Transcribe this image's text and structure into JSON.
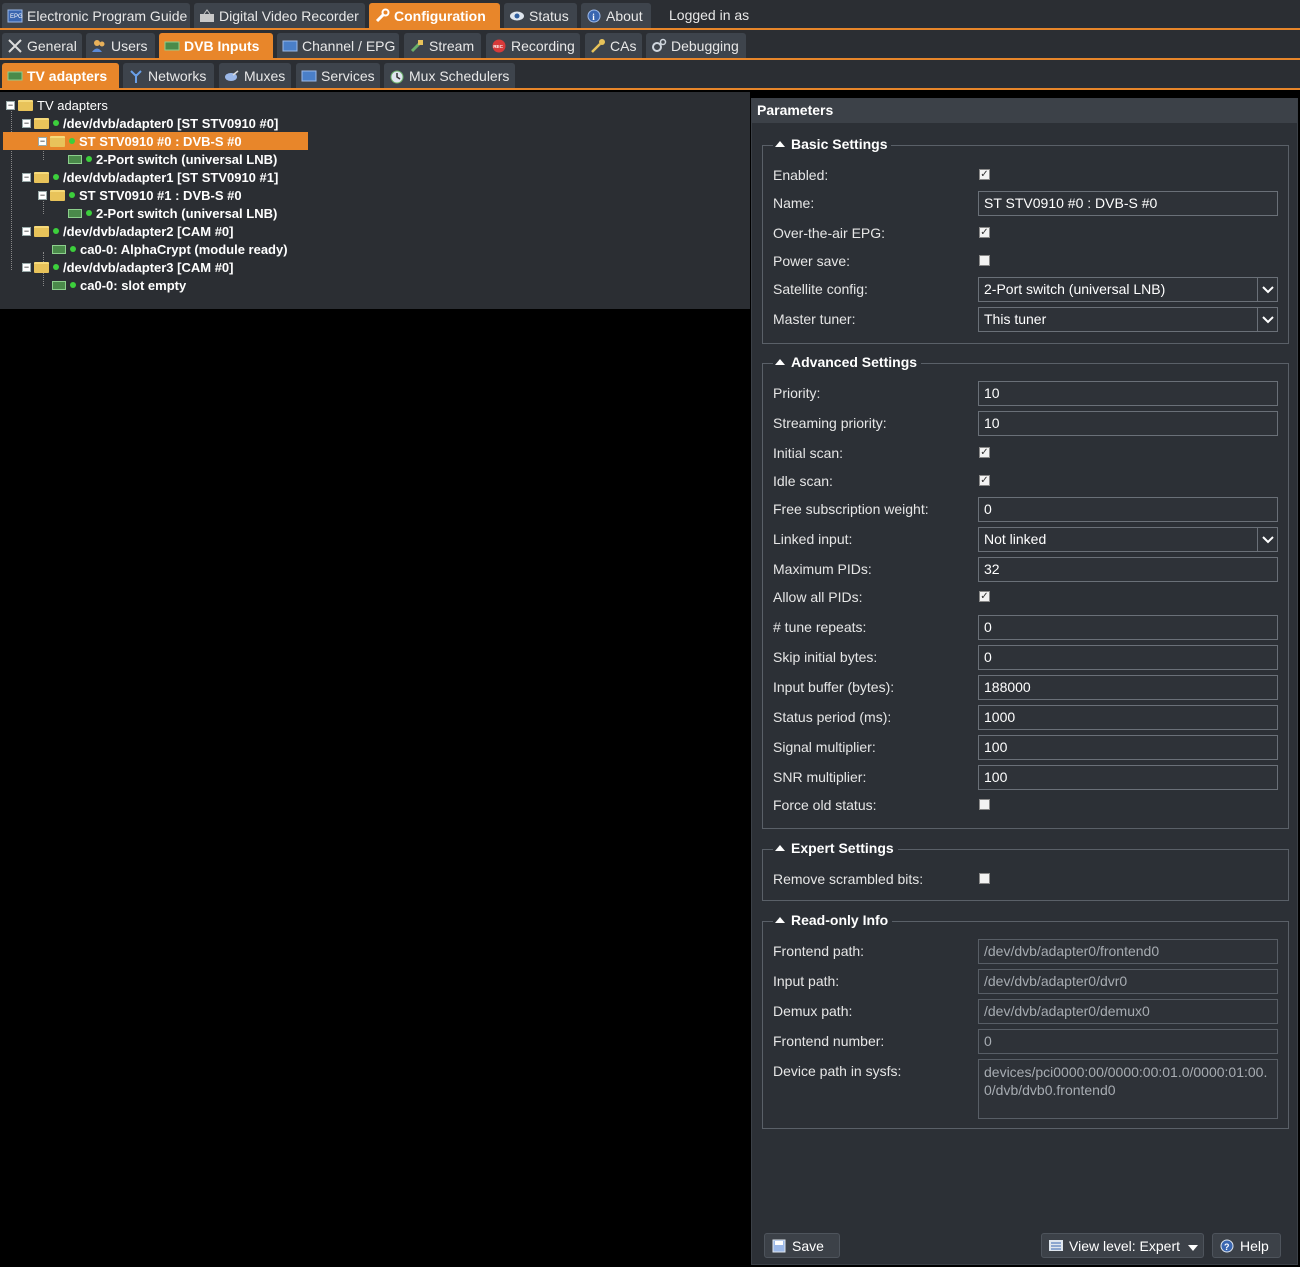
{
  "topnav": {
    "tabs": [
      {
        "label": "Electronic Program Guide",
        "icon": "epg-icon"
      },
      {
        "label": "Digital Video Recorder",
        "icon": "recorder-icon"
      },
      {
        "label": "Configuration",
        "icon": "wrench-icon",
        "active": true
      },
      {
        "label": "Status",
        "icon": "eye-icon"
      },
      {
        "label": "About",
        "icon": "info-icon"
      }
    ],
    "login_text": "Logged in as"
  },
  "confignav": {
    "tabs": [
      {
        "label": "General",
        "icon": "tools-icon"
      },
      {
        "label": "Users",
        "icon": "users-icon"
      },
      {
        "label": "DVB Inputs",
        "icon": "card-icon",
        "active": true
      },
      {
        "label": "Channel / EPG",
        "icon": "tv-icon"
      },
      {
        "label": "Stream",
        "icon": "stream-icon"
      },
      {
        "label": "Recording",
        "icon": "rec-icon"
      },
      {
        "label": "CAs",
        "icon": "key-icon"
      },
      {
        "label": "Debugging",
        "icon": "bug-icon"
      }
    ]
  },
  "dvbnav": {
    "tabs": [
      {
        "label": "TV adapters",
        "icon": "card-icon",
        "active": true
      },
      {
        "label": "Networks",
        "icon": "antenna-icon"
      },
      {
        "label": "Muxes",
        "icon": "satellite-icon"
      },
      {
        "label": "Services",
        "icon": "tv-icon"
      },
      {
        "label": "Mux Schedulers",
        "icon": "scheduler-icon"
      }
    ]
  },
  "tree": {
    "root": "TV adapters",
    "nodes": [
      "/dev/dvb/adapter0 [ST STV0910 #0]",
      "ST STV0910 #0 : DVB-S #0",
      "2-Port switch (universal LNB)",
      "/dev/dvb/adapter1 [ST STV0910 #1]",
      "ST STV0910 #1 : DVB-S #0",
      "2-Port switch (universal LNB)",
      "/dev/dvb/adapter2 [CAM #0]",
      "ca0-0: AlphaCrypt (module ready)",
      "/dev/dvb/adapter3 [CAM #0]",
      "ca0-0: slot empty"
    ]
  },
  "params": {
    "title": "Parameters",
    "basic": {
      "legend": "Basic Settings",
      "enabled_label": "Enabled:",
      "enabled": true,
      "name_label": "Name:",
      "name_value": "ST STV0910 #0 : DVB-S #0",
      "ota_epg_label": "Over-the-air EPG:",
      "ota_epg": true,
      "power_save_label": "Power save:",
      "power_save": false,
      "sat_config_label": "Satellite config:",
      "sat_config_value": "2-Port switch (universal LNB)",
      "master_tuner_label": "Master tuner:",
      "master_tuner_value": "This tuner"
    },
    "advanced": {
      "legend": "Advanced Settings",
      "priority_label": "Priority:",
      "priority_value": "10",
      "streaming_priority_label": "Streaming priority:",
      "streaming_priority_value": "10",
      "initial_scan_label": "Initial scan:",
      "initial_scan": true,
      "idle_scan_label": "Idle scan:",
      "idle_scan": true,
      "free_sub_weight_label": "Free subscription weight:",
      "free_sub_weight_value": "0",
      "linked_input_label": "Linked input:",
      "linked_input_value": "Not linked",
      "max_pids_label": "Maximum PIDs:",
      "max_pids_value": "32",
      "allow_all_pids_label": "Allow all PIDs:",
      "allow_all_pids": true,
      "tune_repeats_label": "# tune repeats:",
      "tune_repeats_value": "0",
      "skip_initial_bytes_label": "Skip initial bytes:",
      "skip_initial_bytes_value": "0",
      "input_buffer_label": "Input buffer (bytes):",
      "input_buffer_value": "188000",
      "status_period_label": "Status period (ms):",
      "status_period_value": "1000",
      "signal_multiplier_label": "Signal multiplier:",
      "signal_multiplier_value": "100",
      "snr_multiplier_label": "SNR multiplier:",
      "snr_multiplier_value": "100",
      "force_old_status_label": "Force old status:",
      "force_old_status": false
    },
    "expert": {
      "legend": "Expert Settings",
      "remove_scrambled_label": "Remove scrambled bits:",
      "remove_scrambled": false
    },
    "readonly": {
      "legend": "Read-only Info",
      "frontend_path_label": "Frontend path:",
      "frontend_path_value": "/dev/dvb/adapter0/frontend0",
      "input_path_label": "Input path:",
      "input_path_value": "/dev/dvb/adapter0/dvr0",
      "demux_path_label": "Demux path:",
      "demux_path_value": "/dev/dvb/adapter0/demux0",
      "frontend_number_label": "Frontend number:",
      "frontend_number_value": "0",
      "sysfs_path_label": "Device path in sysfs:",
      "sysfs_path_value": "devices/pci0000:00/0000:00:01.0/0000:01:00.0/dvb/dvb0.frontend0"
    }
  },
  "footer": {
    "save_label": "Save",
    "view_level_label": "View level: Expert",
    "help_label": "Help"
  },
  "colors": {
    "accent": "#e8862a",
    "background": "#2b2e33",
    "panel": "#2c3036",
    "status_dot": "#3ccf3c"
  }
}
